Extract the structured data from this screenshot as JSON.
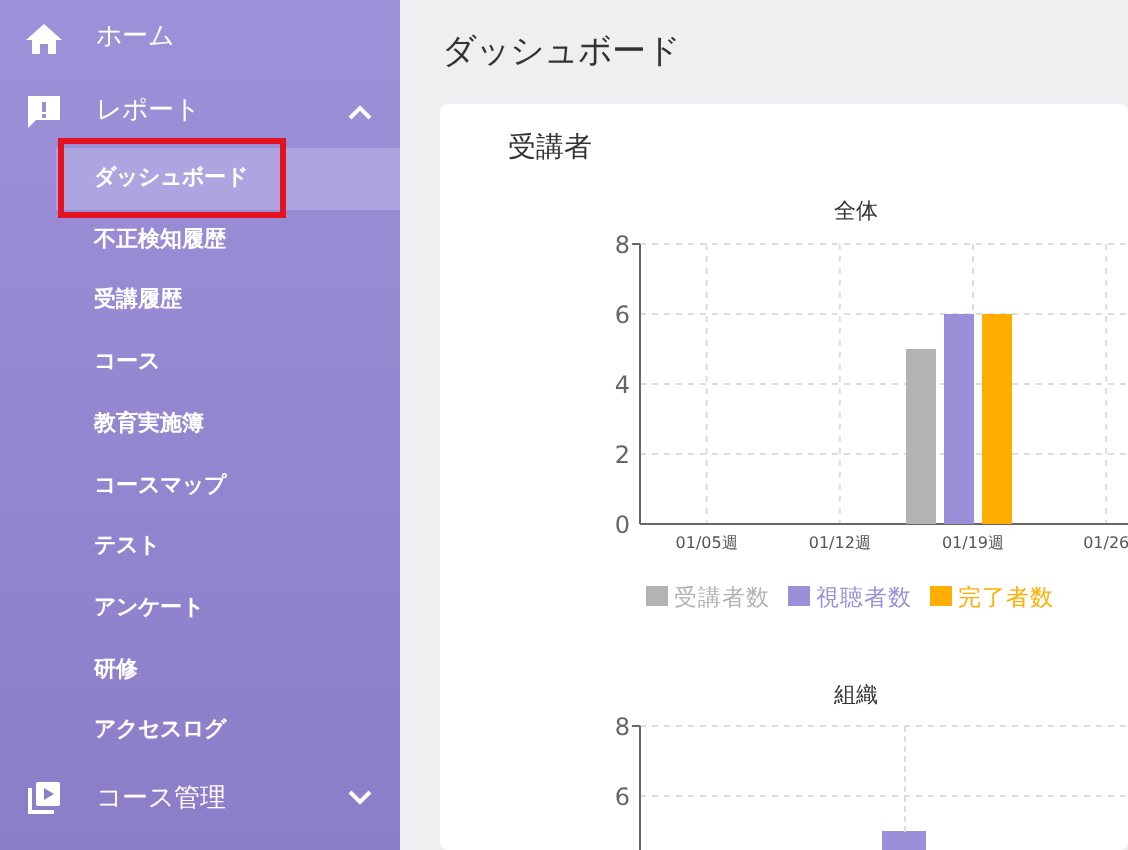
{
  "sidebar": {
    "items": [
      {
        "kind": "home",
        "label": "ホーム"
      },
      {
        "kind": "report",
        "label": "レポート",
        "expanded": true,
        "children": [
          {
            "label": "ダッシュボード",
            "selected": true,
            "highlighted": true
          },
          {
            "label": "不正検知履歴",
            "selected": false,
            "highlighted": false
          },
          {
            "label": "受講履歴",
            "selected": false,
            "highlighted": false
          },
          {
            "label": "コース",
            "selected": false,
            "highlighted": false
          },
          {
            "label": "教育実施簿",
            "selected": false,
            "highlighted": false
          },
          {
            "label": "コースマップ",
            "selected": false,
            "highlighted": false
          },
          {
            "label": "テスト",
            "selected": false,
            "highlighted": false
          },
          {
            "label": "アンケート",
            "selected": false,
            "highlighted": false
          },
          {
            "label": "研修",
            "selected": false,
            "highlighted": false
          },
          {
            "label": "アクセスログ",
            "selected": false,
            "highlighted": false
          }
        ]
      },
      {
        "kind": "courses",
        "label": "コース管理",
        "expanded": false
      }
    ]
  },
  "page_title": "ダッシュボード",
  "card": {
    "title": "受講者",
    "charts": [
      {
        "chart_data": {
          "type": "bar",
          "title": "全体",
          "categories": [
            "01/05週",
            "01/12週",
            "01/19週",
            "01/26"
          ],
          "ylim": [
            0,
            8
          ],
          "yticks": [
            0,
            2,
            4,
            6,
            8
          ],
          "grid": true,
          "legend": "bottom",
          "series": [
            {
              "name": "受講者数",
              "color": "#b3b3b3",
              "values": [
                0,
                0,
                5,
                null
              ]
            },
            {
              "name": "視聴者数",
              "color": "#9b8fd8",
              "values": [
                0,
                0,
                6,
                null
              ]
            },
            {
              "name": "完了者数",
              "color": "#ffad00",
              "values": [
                0,
                0,
                6,
                null
              ]
            }
          ]
        }
      },
      {
        "chart_data": {
          "type": "bar",
          "title": "組織",
          "ylim": [
            0,
            8
          ],
          "yticks": [
            6,
            8
          ],
          "grid": true,
          "series": [
            {
              "color": "#9b8fd8",
              "values": [
                5
              ]
            }
          ]
        }
      }
    ]
  }
}
